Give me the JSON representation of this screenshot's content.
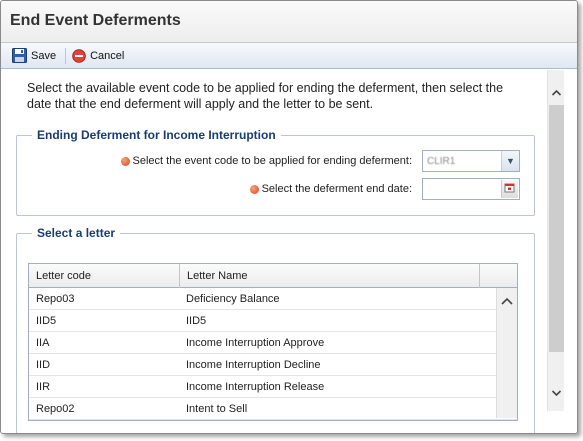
{
  "dialog": {
    "title": "End Event Deferments"
  },
  "toolbar": {
    "save_label": "Save",
    "cancel_label": "Cancel"
  },
  "intro_text": "Select the available event code to be applied for ending the deferment, then select the date that the end deferment will apply and the letter to be sent.",
  "ending_group": {
    "legend": "Ending Deferment for Income Interruption",
    "event_code_label": "Select the event code to be applied for ending deferment:",
    "event_code_value": "CLIR1",
    "end_date_label": "Select the deferment end date:",
    "end_date_value": ""
  },
  "letter_group": {
    "legend": "Select a letter",
    "columns": [
      "Letter code",
      "Letter Name"
    ],
    "rows": [
      {
        "code": "Repo03",
        "name": "Deficiency Balance"
      },
      {
        "code": "IID5",
        "name": "IID5"
      },
      {
        "code": "IIA",
        "name": "Income Interruption Approve"
      },
      {
        "code": "IID",
        "name": "Income Interruption Decline"
      },
      {
        "code": "IIR",
        "name": "Income Interruption Release"
      },
      {
        "code": "Repo02",
        "name": "Intent to Sell"
      }
    ]
  },
  "colors": {
    "legend": "#1a3c73",
    "required": "#d8431a",
    "toolbar": "#dfe7f1"
  }
}
